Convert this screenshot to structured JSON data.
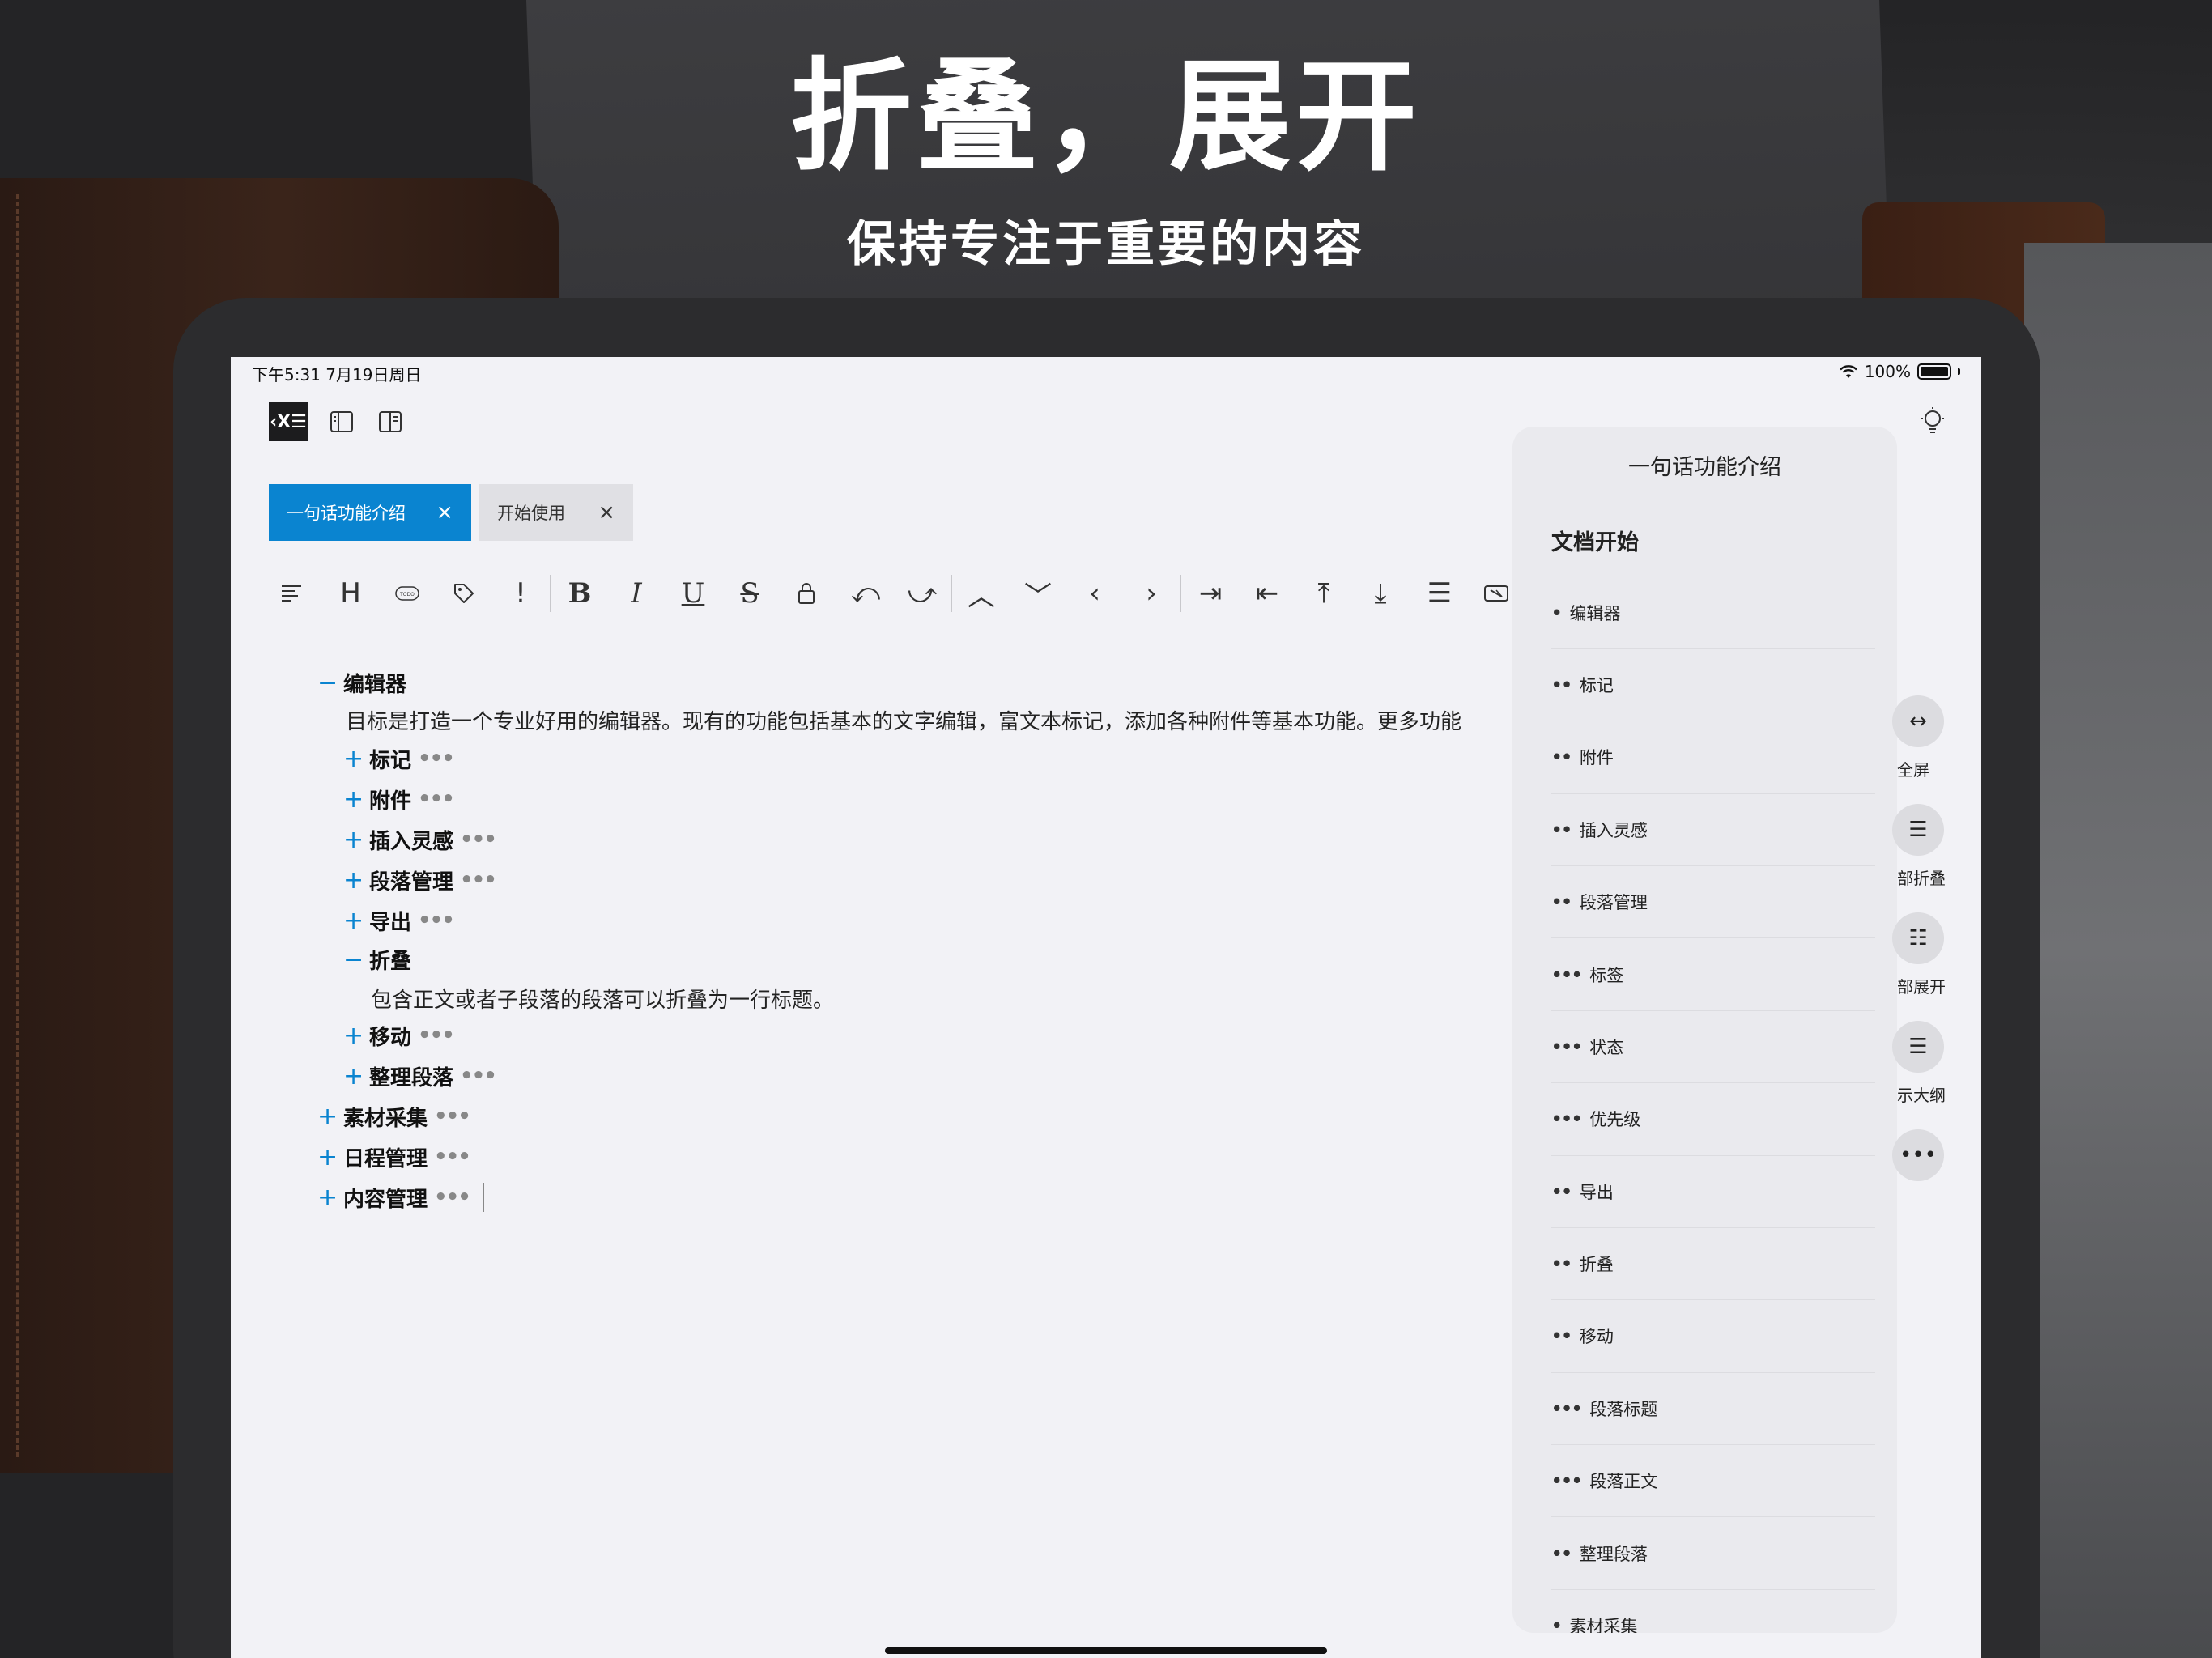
{
  "hero": {
    "title": "折叠，展开",
    "subtitle": "保持专注于重要的内容"
  },
  "status_bar": {
    "time": "下午5:31   7月19日周日",
    "battery": "100%"
  },
  "topbar": {
    "logo": "‹X☰"
  },
  "tabs": [
    {
      "label": "一句话功能介绍",
      "close": "×",
      "active": true
    },
    {
      "label": "开始使用",
      "close": "×",
      "active": false
    }
  ],
  "toolbar": {
    "heading": "H",
    "todo": "TODO",
    "important": "!",
    "bold": "B",
    "italic": "I",
    "underline": "U",
    "strike": "S",
    "undo": "⤺",
    "redo": "⤻",
    "up": "︿",
    "down": "﹀",
    "left": "‹",
    "right": "›",
    "indent": "⇥",
    "outdent": "⇤",
    "to_top": "⤒",
    "to_bottom": "⤓",
    "lines": "☰"
  },
  "editor": {
    "items": [
      {
        "marker": "−",
        "title": "编辑器",
        "dots": ""
      },
      {
        "body": "目标是打造一个专业好用的编辑器。现有的功能包括基本的文字编辑，富文本标记，添加各种附件等基本功能。更多功能"
      },
      {
        "marker": "+",
        "title": "标记",
        "dots": "•••"
      },
      {
        "marker": "+",
        "title": "附件",
        "dots": "•••"
      },
      {
        "marker": "+",
        "title": "插入灵感",
        "dots": "•••"
      },
      {
        "marker": "+",
        "title": "段落管理",
        "dots": "•••"
      },
      {
        "marker": "+",
        "title": "导出",
        "dots": "•••"
      },
      {
        "marker": "−",
        "title": "折叠",
        "dots": ""
      },
      {
        "body": "包含正文或者子段落的段落可以折叠为一行标题。"
      },
      {
        "marker": "+",
        "title": "移动",
        "dots": "•••"
      },
      {
        "marker": "+",
        "title": "整理段落",
        "dots": "•••"
      },
      {
        "marker": "+",
        "title": "素材采集",
        "dots": "•••"
      },
      {
        "marker": "+",
        "title": "日程管理",
        "dots": "•••"
      },
      {
        "marker": "+",
        "title": "内容管理",
        "dots": "•••"
      }
    ]
  },
  "outline": {
    "header": "一句话功能介绍",
    "items": [
      {
        "prefix": "",
        "label": "文档开始"
      },
      {
        "prefix": "•",
        "label": "编辑器"
      },
      {
        "prefix": "••",
        "label": "标记"
      },
      {
        "prefix": "••",
        "label": "附件"
      },
      {
        "prefix": "••",
        "label": "插入灵感"
      },
      {
        "prefix": "••",
        "label": "段落管理"
      },
      {
        "prefix": "•••",
        "label": "标签"
      },
      {
        "prefix": "•••",
        "label": "状态"
      },
      {
        "prefix": "•••",
        "label": "优先级"
      },
      {
        "prefix": "••",
        "label": "导出"
      },
      {
        "prefix": "••",
        "label": "折叠"
      },
      {
        "prefix": "••",
        "label": "移动"
      },
      {
        "prefix": "•••",
        "label": "段落标题"
      },
      {
        "prefix": "•••",
        "label": "段落正文"
      },
      {
        "prefix": "••",
        "label": "整理段落"
      },
      {
        "prefix": "•",
        "label": "素材采集"
      }
    ]
  },
  "side_actions": [
    {
      "icon": "↔",
      "label": "全屏"
    },
    {
      "icon": "☰",
      "label": "部折叠"
    },
    {
      "icon": "☷",
      "label": "部展开"
    },
    {
      "icon": "☰",
      "label": "示大纲"
    },
    {
      "icon": "•••",
      "label": ""
    }
  ]
}
